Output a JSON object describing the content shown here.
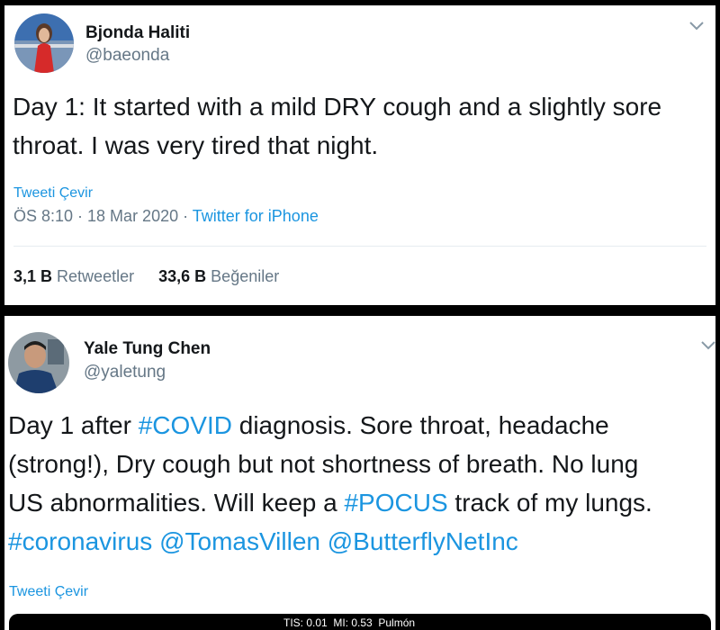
{
  "tweet1": {
    "name": "Bjonda Haliti",
    "handle": "@baeonda",
    "lines": [
      "Day 1: It started with a mild DRY cough and a slightly sore",
      "throat. I was very tired that night."
    ],
    "translate": "Tweeti Çevir",
    "time": "ÖS 8:10 · 18 Mar 2020 · ",
    "client": "Twitter for iPhone",
    "retweets_count": "3,1 B",
    "retweets_label": "Retweetler",
    "likes_count": "33,6 B",
    "likes_label": "Beğeniler",
    "chevron": "chevron-down-icon"
  },
  "tweet2": {
    "name": "Yale Tung Chen",
    "handle": "@yaletung",
    "line1_pre": "Day 1 after ",
    "line1_tag": "#COVID",
    "line1_post": " diagnosis. Sore throat, headache",
    "line2": "(strong!), Dry cough but not shortness of breath. No lung",
    "line3_pre": "US abnormalities. Will keep a ",
    "line3_tag": "#POCUS",
    "line3_post": " track of my lungs.",
    "line4_tag": "#coronavirus",
    "line4_m1": "@TomasVillen",
    "line4_m2": "@ButterflyNetInc",
    "translate": "Tweeti Çevir",
    "media_caption": "TIS: 0.01  MI: 0.53  Pulmón",
    "chevron": "chevron-down-icon"
  },
  "colors": {
    "link": "#1b95e0",
    "text": "#14171a",
    "muted": "#657786"
  }
}
